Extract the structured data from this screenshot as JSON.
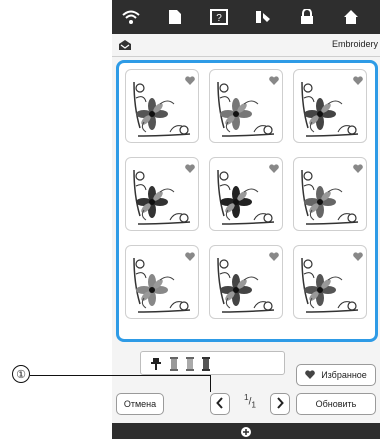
{
  "header": {
    "title": "Embroidery"
  },
  "buttons": {
    "favorites": "Избранное",
    "cancel": "Отмена",
    "refresh": "Обновить"
  },
  "page_indicator": {
    "current": "1",
    "total": "1"
  },
  "callout": {
    "number": "①"
  },
  "icons": {
    "topbar": [
      "wifi-icon",
      "document-icon",
      "help-icon",
      "thread-icon",
      "lock-icon",
      "home-icon"
    ],
    "header": "embroidery-mode-icon",
    "favorite": "heart-icon",
    "prev": "chevron-left-icon",
    "next": "chevron-right-icon"
  },
  "colors": {
    "accent": "#2e9be6",
    "bar": "#2e2e2e"
  }
}
